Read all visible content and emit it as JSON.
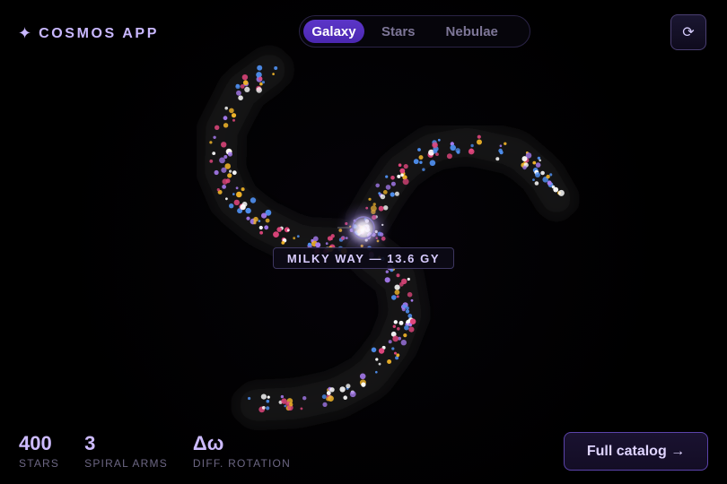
{
  "brand": {
    "icon": "sparkle-icon",
    "icon_glyph": "✦",
    "name": "COSMOS APP"
  },
  "tabs": [
    {
      "label": "Galaxy",
      "active": true
    },
    {
      "label": "Stars",
      "active": false
    },
    {
      "label": "Nebulae",
      "active": false
    }
  ],
  "toolbar": {
    "refresh_icon": "refresh-icon",
    "refresh_glyph": "⟳"
  },
  "galaxy": {
    "label": "MILKY WAY — 13.6 GY",
    "star_colors": [
      "#f0b429",
      "#4f8ff0",
      "#e0467c",
      "#a77bf0",
      "#ffffff"
    ],
    "core_color": "#ffffff",
    "arm_shadow": "#1a1a1a"
  },
  "stats": [
    {
      "value": "400",
      "label": "STARS"
    },
    {
      "value": "3",
      "label": "SPIRAL ARMS"
    },
    {
      "value": "Δω",
      "label": "DIFF. ROTATION"
    }
  ],
  "actions": {
    "catalog_label": "Full catalog →"
  },
  "colors": {
    "accent": "#5c36c8",
    "text": "#d8ccff",
    "muted": "#6c6683"
  }
}
